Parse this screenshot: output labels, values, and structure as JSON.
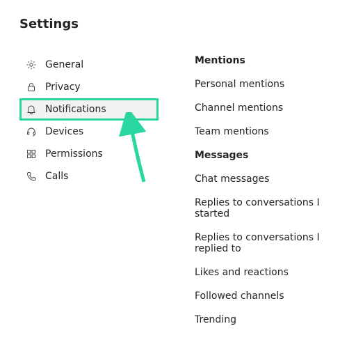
{
  "title": "Settings",
  "sidebar": {
    "items": [
      {
        "label": "General"
      },
      {
        "label": "Privacy"
      },
      {
        "label": "Notifications"
      },
      {
        "label": "Devices"
      },
      {
        "label": "Permissions"
      },
      {
        "label": "Calls"
      }
    ]
  },
  "sections": [
    {
      "heading": "Mentions",
      "items": [
        "Personal mentions",
        "Channel mentions",
        "Team mentions"
      ]
    },
    {
      "heading": "Messages",
      "items": [
        "Chat messages",
        "Replies to conversations I started",
        "Replies to conversations I replied to",
        "Likes and reactions",
        "Followed channels",
        "Trending"
      ]
    }
  ],
  "annotation": {
    "highlight_color": "#2ad6a0"
  }
}
